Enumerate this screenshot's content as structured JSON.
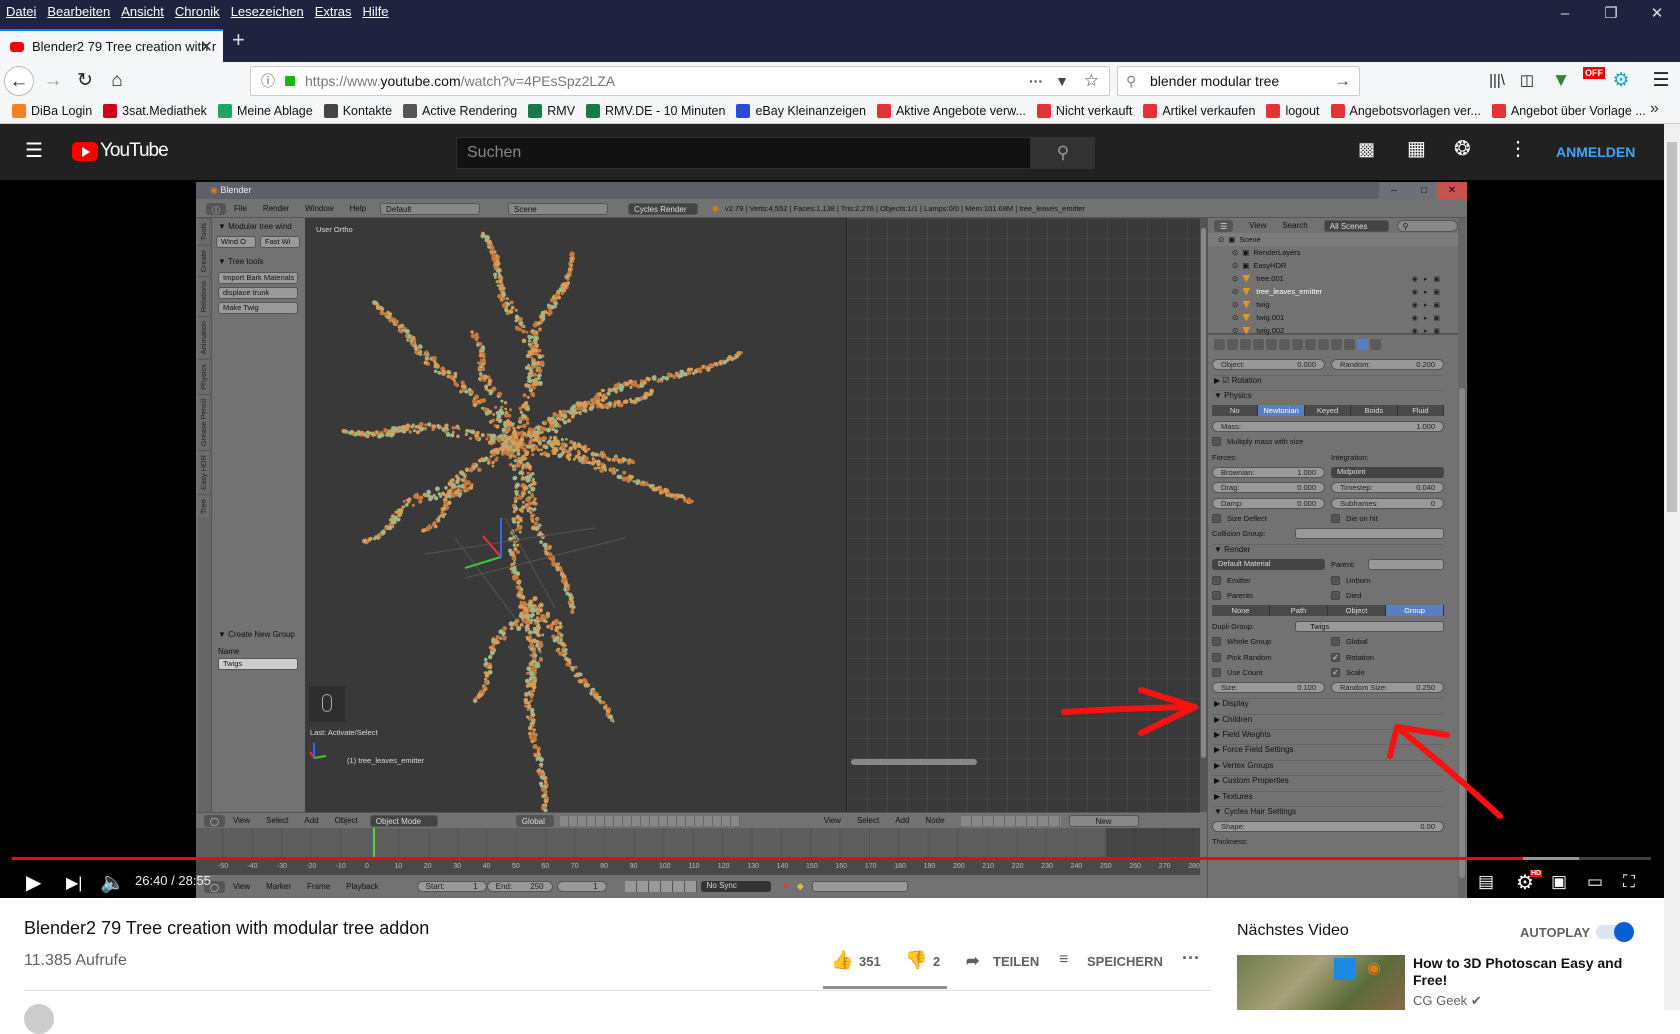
{
  "browser": {
    "menu": [
      "Datei",
      "Bearbeiten",
      "Ansicht",
      "Chronik",
      "Lesezeichen",
      "Extras",
      "Hilfe"
    ],
    "tab_title": "Blender2 79 Tree creation with r",
    "url_prefix": "https://www.",
    "url_domain": "youtube.com",
    "url_path": "/watch?v=4PEsSpz2LZA",
    "search_value": "blender modular tree",
    "extension_badge": "OFF",
    "bookmarks": [
      {
        "label": "DiBa Login",
        "color": "#f58220"
      },
      {
        "label": "3sat.Mediathek",
        "color": "#d0021b"
      },
      {
        "label": "Meine Ablage",
        "color": "#1fa463"
      },
      {
        "label": "Kontakte",
        "color": "#444444"
      },
      {
        "label": "Active Rendering",
        "color": "#555555"
      },
      {
        "label": "RMV",
        "color": "#1a7a4a"
      },
      {
        "label": "RMV.DE - 10 Minuten",
        "color": "#1a7a4a"
      },
      {
        "label": "eBay Kleinanzeigen",
        "color": "#2b4bd6"
      },
      {
        "label": "Aktive Angebote verw...",
        "color": "#e53238"
      },
      {
        "label": "Nicht verkauft",
        "color": "#e53238"
      },
      {
        "label": "Artikel verkaufen",
        "color": "#e53238"
      },
      {
        "label": "logout",
        "color": "#e53238"
      },
      {
        "label": "Angebotsvorlagen ver...",
        "color": "#e53238"
      },
      {
        "label": "Angebot über Vorlage ...",
        "color": "#e53238"
      }
    ]
  },
  "youtube": {
    "logo": "YouTube",
    "search_placeholder": "Suchen",
    "signin": "ANMELDEN",
    "accent": "#ff0000"
  },
  "blender": {
    "title": "Blender",
    "menu": [
      "File",
      "Render",
      "Window",
      "Help"
    ],
    "layout": "Default",
    "scene": "Scene",
    "engine": "Cycles Render",
    "stats": "v2.79 | Verts:4,552 | Faces:1,138 | Tris:2,276 | Objects:1/1 | Lamps:0/0 | Mem:101.68M | tree_leaves_emitter",
    "vtabs": [
      "Tools",
      "Create",
      "Relations",
      "Animation",
      "Physics",
      "Grease Pencil",
      "Easy HDR",
      "Tree"
    ],
    "panel_wind": "Modular tree wind",
    "wind_buttons": [
      "Wind O",
      "Fast Wi"
    ],
    "panel_tree": "Tree tools",
    "tree_buttons": [
      "Import Bark Materials",
      "displace trunk",
      "Make Twig"
    ],
    "panel_group": "Create New Group",
    "group_name_label": "Name",
    "group_name_value": "Twigs",
    "viewport_label": "User Ortho",
    "last_op": "Last: Activate/Select",
    "active_object": "(1) tree_leaves_emitter",
    "view3d_header": [
      "View",
      "Select",
      "Add",
      "Object"
    ],
    "mode": "Object Mode",
    "orientation": "Global",
    "node_header": [
      "View",
      "Select",
      "Add",
      "Node"
    ],
    "node_new": "New",
    "timeline_header": [
      "View",
      "Marker",
      "Frame",
      "Playback"
    ],
    "start_label": "Start:",
    "start": "1",
    "end_label": "End:",
    "end": "250",
    "current_frame": "1",
    "sync": "No Sync",
    "ruler": [
      "-50",
      "-40",
      "-30",
      "-20",
      "-10",
      "0",
      "10",
      "20",
      "30",
      "40",
      "50",
      "60",
      "70",
      "80",
      "90",
      "100",
      "110",
      "120",
      "130",
      "140",
      "150",
      "160",
      "170",
      "180",
      "190",
      "200",
      "210",
      "220",
      "230",
      "240",
      "250",
      "260",
      "270",
      "280"
    ],
    "outliner": {
      "menu": [
        "View",
        "Search"
      ],
      "filter": "All Scenes",
      "rows": [
        {
          "label": "Scene",
          "indent": 0
        },
        {
          "label": "RenderLayers",
          "indent": 1
        },
        {
          "label": "EasyHDR",
          "indent": 1
        },
        {
          "label": "tree.001",
          "indent": 1,
          "mesh": true
        },
        {
          "label": "tree_leaves_emitter",
          "indent": 1,
          "mesh": true,
          "active": true
        },
        {
          "label": "twig",
          "indent": 1,
          "mesh": true
        },
        {
          "label": "twig.001",
          "indent": 1,
          "mesh": true
        },
        {
          "label": "twig.002",
          "indent": 1,
          "mesh": true
        }
      ]
    },
    "props": [
      [
        {
          "k": "field",
          "label": "Object:",
          "value": "0.000"
        },
        {
          "k": "field",
          "label": "Random:",
          "value": "0.200"
        }
      ],
      [
        {
          "k": "section",
          "label": "Rotation",
          "open": false,
          "checkbox": true
        }
      ],
      [
        {
          "k": "section",
          "label": "Physics",
          "open": true
        }
      ],
      [
        {
          "k": "toggle",
          "items": [
            "No",
            "Newtonian",
            "Keyed",
            "Boids",
            "Fluid"
          ],
          "active": "Newtonian"
        }
      ],
      [
        {
          "k": "field",
          "label": "Mass:",
          "value": "1.000"
        }
      ],
      [
        {
          "k": "check",
          "label": "Multiply mass with size",
          "checked": false
        }
      ],
      [
        {
          "k": "label",
          "label": "Forces:"
        },
        {
          "k": "label",
          "label": "Integration:"
        }
      ],
      [
        {
          "k": "field",
          "label": "Brownian:",
          "value": "1.000"
        },
        {
          "k": "dropdown",
          "label": "Midpoint"
        }
      ],
      [
        {
          "k": "field",
          "label": "Drag:",
          "value": "0.000"
        },
        {
          "k": "field",
          "label": "Timestep:",
          "value": "0.040"
        }
      ],
      [
        {
          "k": "field",
          "label": "Damp:",
          "value": "0.000"
        },
        {
          "k": "field",
          "label": "Subframes:",
          "value": "0"
        }
      ],
      [
        {
          "k": "check",
          "label": "Size Deflect",
          "checked": false
        },
        {
          "k": "check",
          "label": "Die on hit",
          "checked": false
        }
      ],
      [
        {
          "k": "picker",
          "label": "Collision Group:",
          "value": ""
        }
      ],
      [
        {
          "k": "section",
          "label": "Render",
          "open": true
        }
      ],
      [
        {
          "k": "dropdown",
          "label": "Default Material"
        },
        {
          "k": "picker",
          "label": "Parent:",
          "value": ""
        }
      ],
      [
        {
          "k": "check",
          "label": "Emitter",
          "checked": false
        },
        {
          "k": "check",
          "label": "Unborn",
          "checked": false
        }
      ],
      [
        {
          "k": "check",
          "label": "Parents",
          "checked": false
        },
        {
          "k": "check",
          "label": "Died",
          "checked": false
        }
      ],
      [
        {
          "k": "toggle",
          "items": [
            "None",
            "Path",
            "Object",
            "Group"
          ],
          "active": "Group"
        }
      ],
      [
        {
          "k": "picker",
          "label": "Dupli Group:",
          "value": "Twigs"
        }
      ],
      [
        {
          "k": "check",
          "label": "Whole Group",
          "checked": false
        },
        {
          "k": "check",
          "label": "Global",
          "checked": false
        }
      ],
      [
        {
          "k": "check",
          "label": "Pick Random",
          "checked": false
        },
        {
          "k": "check",
          "label": "Rotation",
          "checked": true
        }
      ],
      [
        {
          "k": "check",
          "label": "Use Count",
          "checked": false
        },
        {
          "k": "check",
          "label": "Scale",
          "checked": true
        }
      ],
      [
        {
          "k": "field",
          "label": "Size:",
          "value": "0.100"
        },
        {
          "k": "field",
          "label": "Random Size:",
          "value": "0.250"
        }
      ],
      [
        {
          "k": "section",
          "label": "Display",
          "open": false
        }
      ],
      [
        {
          "k": "section",
          "label": "Children",
          "open": false
        }
      ],
      [
        {
          "k": "section",
          "label": "Field Weights",
          "open": false
        }
      ],
      [
        {
          "k": "section",
          "label": "Force Field Settings",
          "open": false
        }
      ],
      [
        {
          "k": "section",
          "label": "Vertex Groups",
          "open": false
        }
      ],
      [
        {
          "k": "section",
          "label": "Custom Properties",
          "open": false
        }
      ],
      [
        {
          "k": "section",
          "label": "Textures",
          "open": false
        }
      ],
      [
        {
          "k": "section",
          "label": "Cycles Hair Settings",
          "open": true
        }
      ],
      [
        {
          "k": "field",
          "label": "Shape:",
          "value": "0.00"
        }
      ],
      [
        {
          "k": "label",
          "label": "Thickness:"
        }
      ]
    ]
  },
  "player": {
    "time": "26:40 / 28:55",
    "progress_fraction": 0.922,
    "buffered_fraction": 0.956,
    "hd_badge": "HD"
  },
  "video_info": {
    "title": "Blender2 79 Tree creation with modular tree addon",
    "views": "11.385 Aufrufe",
    "likes": "351",
    "dislikes": "2",
    "share": "TEILEN",
    "save": "SPEICHERN"
  },
  "sidebar": {
    "next_label": "Nächstes Video",
    "autoplay_label": "AUTOPLAY",
    "autoplay_on": true,
    "next_title": "How to 3D Photoscan Easy and Free!",
    "next_channel": "CG Geek"
  }
}
